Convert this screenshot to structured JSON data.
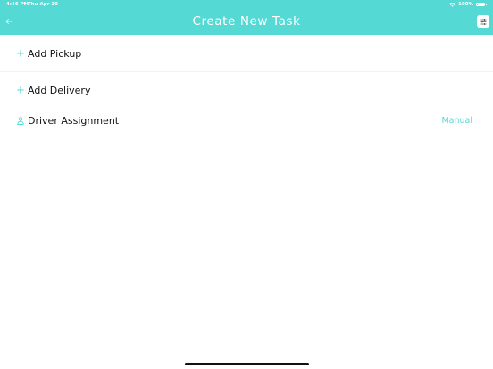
{
  "status_bar": {
    "time": "4:46 PM",
    "date": "Thu Apr 20",
    "battery": "100%",
    "wifi_icon": "wifi-icon",
    "battery_icon": "battery-icon"
  },
  "header": {
    "title": "Create New Task",
    "back_icon": "arrow-left-icon",
    "filter_icon": "sliders-icon"
  },
  "rows": [
    {
      "icon": "plus-icon",
      "label": "Add Pickup"
    },
    {
      "icon": "plus-icon",
      "label": "Add Delivery"
    },
    {
      "icon": "person-icon",
      "label": "Driver Assignment",
      "value": "Manual"
    }
  ],
  "colors": {
    "accent": "#54d9d4",
    "text": "#111111",
    "background": "#ffffff"
  }
}
